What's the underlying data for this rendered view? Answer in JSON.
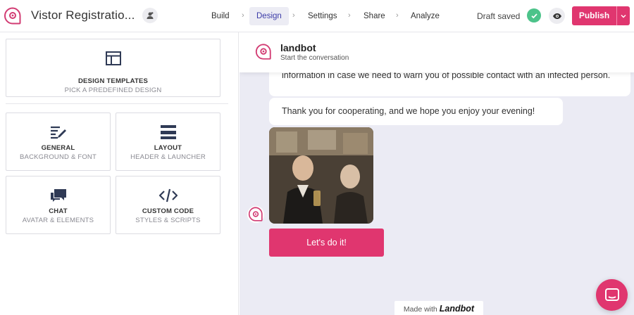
{
  "header": {
    "app_title": "Vistor Registratio...",
    "nav": [
      {
        "label": "Build"
      },
      {
        "label": "Design"
      },
      {
        "label": "Settings"
      },
      {
        "label": "Share"
      },
      {
        "label": "Analyze"
      }
    ],
    "nav_separator": "›",
    "active_tab": "Design",
    "draft_status": "Draft saved",
    "publish_label": "Publish"
  },
  "design_panel": {
    "templates": {
      "title": "DESIGN TEMPLATES",
      "subtitle": "PICK A PREDEFINED DESIGN",
      "icon": "layout-template-icon"
    },
    "cards": [
      {
        "title": "GENERAL",
        "subtitle": "BACKGROUND & FONT",
        "icon": "palette-pen-icon"
      },
      {
        "title": "LAYOUT",
        "subtitle": "HEADER & LAUNCHER",
        "icon": "layout-bars-icon"
      },
      {
        "title": "CHAT",
        "subtitle": "AVATAR & ELEMENTS",
        "icon": "chat-bubbles-icon"
      },
      {
        "title": "CUSTOM CODE",
        "subtitle": "STYLES & SCRIPTS",
        "icon": "code-icon"
      }
    ]
  },
  "preview": {
    "bot_name": "landbot",
    "bot_status": "Start the conversation",
    "messages": [
      {
        "text": "information in case we need to warn you of possible contact with an infected person."
      },
      {
        "text": "Thank you for cooperating, and we hope you enjoy your evening!"
      }
    ],
    "cta_label": "Let's do it!",
    "made_with": "Made with",
    "made_with_brand": "Landbot"
  },
  "colors": {
    "brand_pink": "#e0366f",
    "success_green": "#4cc38a",
    "preview_bg": "#ebebf4",
    "active_tab_bg": "#ececf4"
  }
}
